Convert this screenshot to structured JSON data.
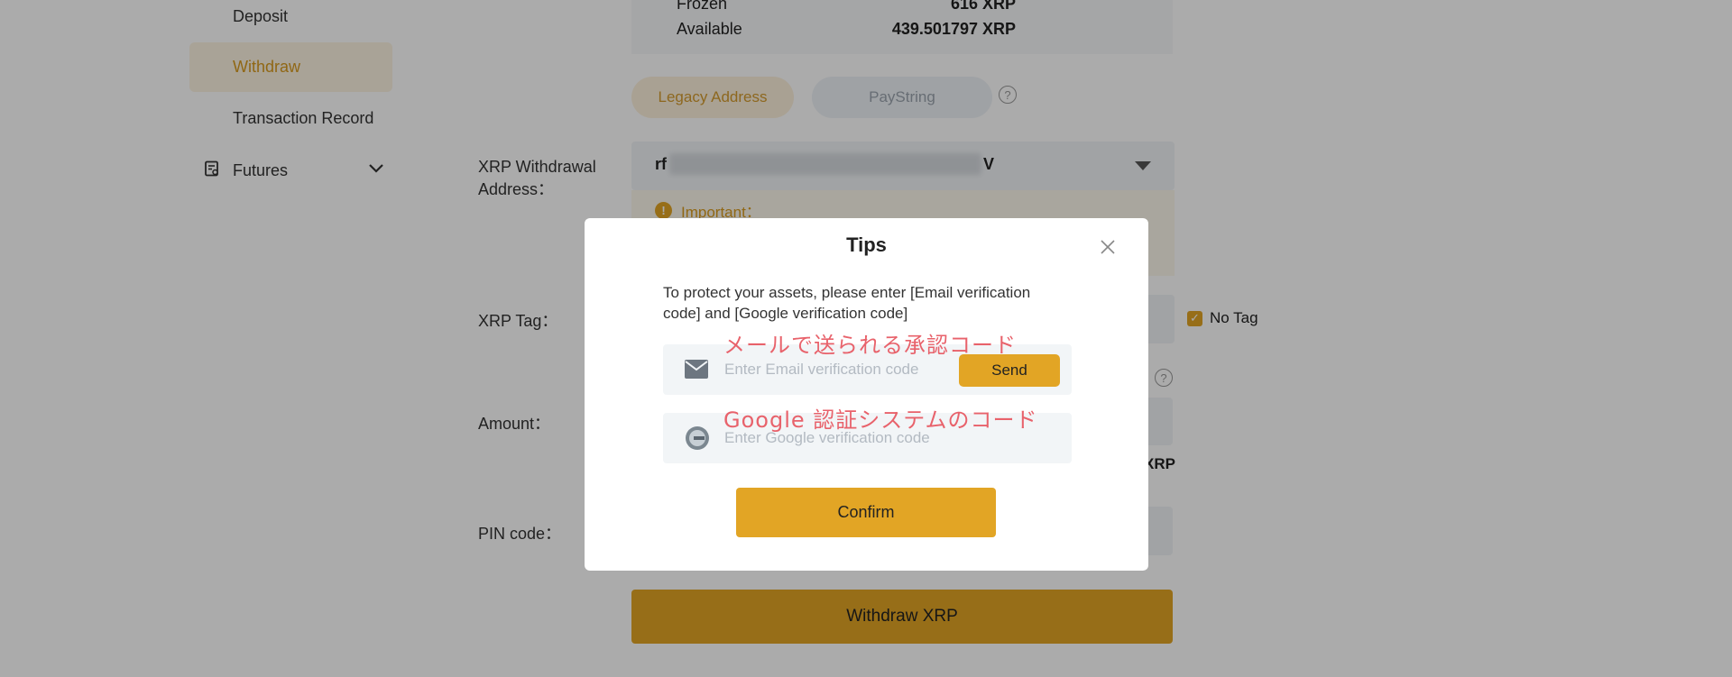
{
  "sidebar": {
    "items": [
      {
        "label": "Deposit"
      },
      {
        "label": "Withdraw"
      },
      {
        "label": "Transaction Record"
      },
      {
        "label": "Futures"
      }
    ]
  },
  "balance": {
    "frozen_label": "Frozen",
    "frozen_value": "616 XRP",
    "available_label": "Available",
    "available_value": "439.501797 XRP"
  },
  "address_tabs": {
    "legacy": "Legacy Address",
    "paystring": "PayString"
  },
  "form": {
    "address_label": "XRP Withdrawal Address：",
    "address_prefix": "rf",
    "address_suffix": "V",
    "important_label": "Important：",
    "tag_label": "XRP Tag：",
    "no_tag_label": "No Tag",
    "amount_label": "Amount：",
    "amount_unit": "XRP",
    "pin_label": "PIN code：",
    "withdraw_button": "Withdraw XRP"
  },
  "modal": {
    "title": "Tips",
    "message": "To protect your assets, please enter [Email verification code] and [Google verification code]",
    "email_annotation": "メールで送られる承認コード",
    "google_annotation": "Google 認証システムのコード",
    "email_placeholder": "Enter Email verification code",
    "send_button": "Send",
    "google_placeholder": "Enter Google verification code",
    "confirm_button": "Confirm"
  },
  "colors": {
    "accent": "#e2a525",
    "annotation": "#e8626b"
  }
}
